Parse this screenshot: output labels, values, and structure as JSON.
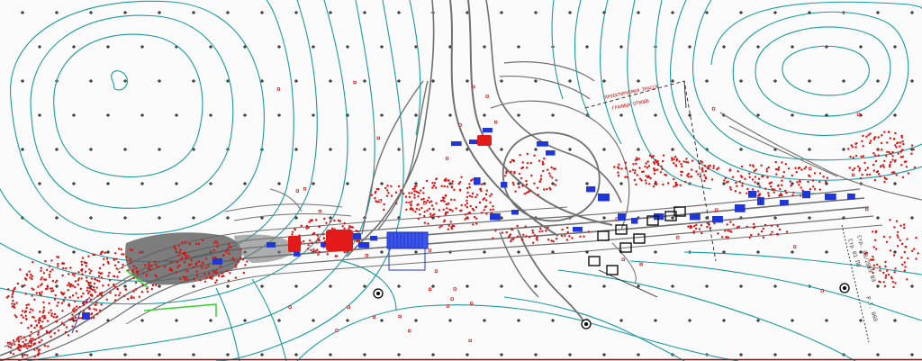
{
  "drawing": {
    "view": "CAD site plan (topographic survey with highway interchange)",
    "colors": {
      "background": "#fbfbfb",
      "contour": "#1a9ba0",
      "road_linework": "#707070",
      "survey_points": "#e01010",
      "structures": "#2036d8",
      "utility_green": "#39d12f",
      "grid_cross": "#000000",
      "bottom_border": "#b00000"
    },
    "icons": [
      "grid-cross-icon",
      "survey-point-icon",
      "benchmark-icon",
      "structure-block-icon"
    ],
    "annotations": {
      "right_vertical": [
        "Стр. 03/2019 ВЭ",
        "Стр 01 ПО",
        "Р.Т. 060"
      ],
      "red_note_1": "ПРОЕКТИРУЕМАЯ ТРАССА",
      "red_note_2": "ГРАНИЦА ОТВОДА"
    }
  }
}
